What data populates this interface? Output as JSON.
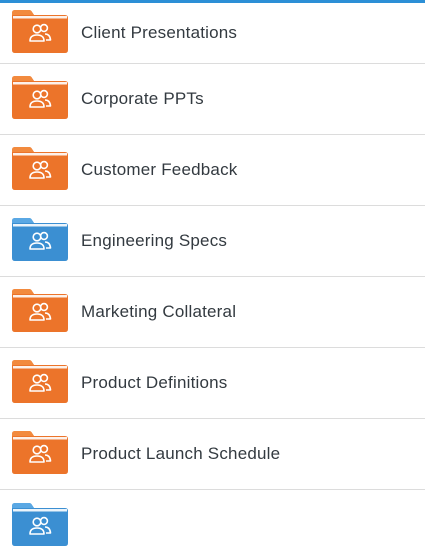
{
  "colors": {
    "accent_bar": "#2c8fd6",
    "folder_orange": "#ec742a",
    "folder_orange_tab": "#f28a3e",
    "folder_blue": "#3b8fd2",
    "folder_blue_tab": "#5aa8e4",
    "text": "#333a40",
    "divider": "#dcdcdc"
  },
  "folders": [
    {
      "label": "Client Presentations",
      "color": "orange",
      "icon": "shared-folder-icon"
    },
    {
      "label": "Corporate PPTs",
      "color": "orange",
      "icon": "shared-folder-icon"
    },
    {
      "label": "Customer Feedback",
      "color": "orange",
      "icon": "shared-folder-icon"
    },
    {
      "label": "Engineering Specs",
      "color": "blue",
      "icon": "shared-folder-icon"
    },
    {
      "label": "Marketing Collateral",
      "color": "orange",
      "icon": "shared-folder-icon"
    },
    {
      "label": "Product Definitions",
      "color": "orange",
      "icon": "shared-folder-icon"
    },
    {
      "label": "Product Launch Schedule",
      "color": "orange",
      "icon": "shared-folder-icon"
    },
    {
      "label": "",
      "color": "blue",
      "icon": "shared-folder-icon"
    }
  ]
}
